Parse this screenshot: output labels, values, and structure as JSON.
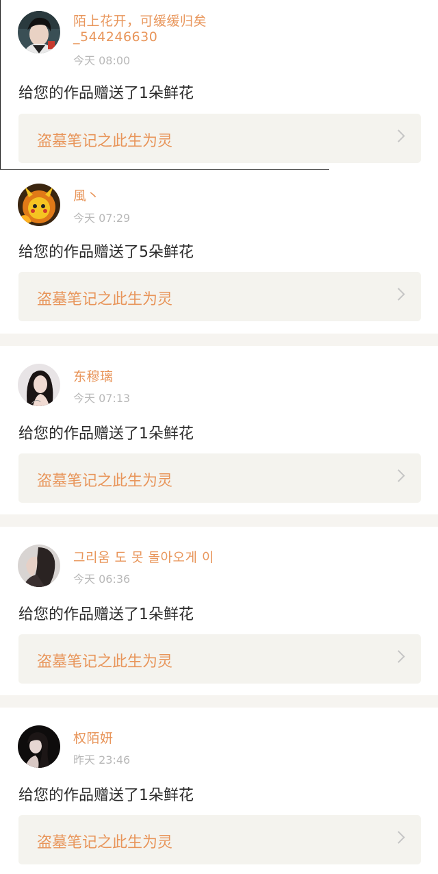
{
  "notifications": [
    {
      "username": "陌上花开，可缓缓归矣_544246630",
      "username_line1": "陌上花开，可缓缓归矣",
      "username_line2": "_544246630",
      "time": "今天 08:00",
      "message": "给您的作品赠送了1朵鲜花",
      "work_title": "盗墓笔记之此生为灵",
      "avatar_icon": "avatar-dark-hair-boy"
    },
    {
      "username": "風丶",
      "time": "今天 07:29",
      "message": "给您的作品赠送了5朵鲜花",
      "work_title": "盗墓笔记之此生为灵",
      "avatar_icon": "avatar-pikachu-fire"
    },
    {
      "username": "东穆璃",
      "time": "今天 07:13",
      "message": "给您的作品赠送了1朵鲜花",
      "work_title": "盗墓笔记之此生为灵",
      "avatar_icon": "avatar-woman-portrait"
    },
    {
      "username": "그리움 도 못 돌아오게 이",
      "time": "今天 06:36",
      "message": "给您的作品赠送了1朵鲜花",
      "work_title": "盗墓笔记之此生为灵",
      "avatar_icon": "avatar-woman-profile"
    },
    {
      "username": "权陌妍",
      "time": "昨天 23:46",
      "message": "给您的作品赠送了1朵鲜花",
      "work_title": "盗墓笔记之此生为灵",
      "avatar_icon": "avatar-dark-portrait"
    }
  ],
  "colors": {
    "accent": "#e8955a",
    "time_gray": "#b8b8b8",
    "link_bg": "#f4f3ee",
    "divider": "#f6f4f0"
  }
}
